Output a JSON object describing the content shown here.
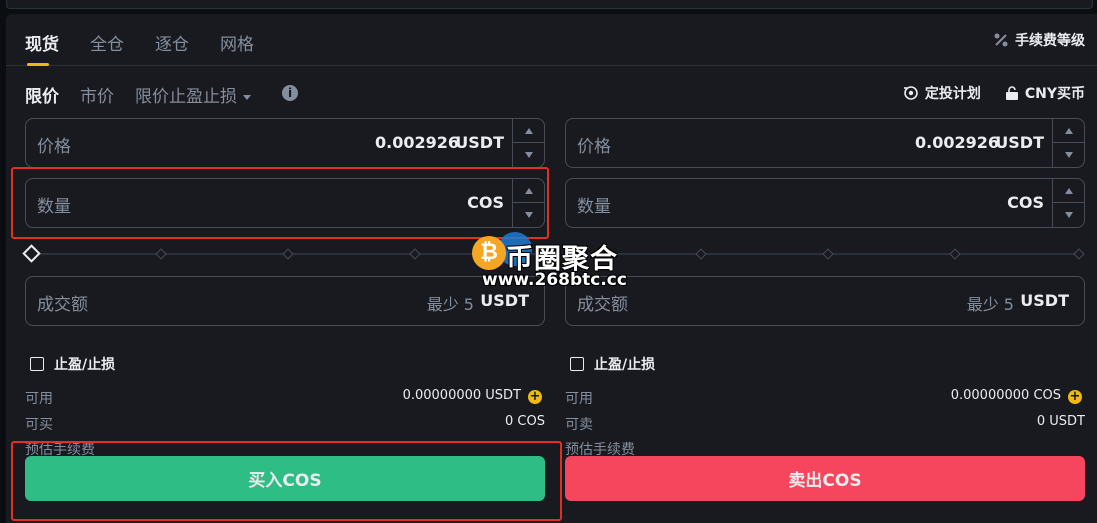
{
  "tabs": [
    {
      "label": "现货",
      "active": true
    },
    {
      "label": "全仓",
      "active": false
    },
    {
      "label": "逐仓",
      "active": false
    },
    {
      "label": "网格",
      "active": false
    }
  ],
  "fee_link": {
    "icon": "percent-icon",
    "label": "手续费等级"
  },
  "order_types": {
    "limit": "限价",
    "market": "市价",
    "stop_limit": "限价止盈止损"
  },
  "right_links": {
    "auto_invest": "定投计划",
    "cny_buy": "CNY买币"
  },
  "buy": {
    "price_label": "价格",
    "price_value": "0.002926",
    "price_unit": "USDT",
    "amount_label": "数量",
    "amount_unit": "COS",
    "total_label": "成交额",
    "total_placeholder": "最少 5",
    "total_unit": "USDT",
    "tpsl_label": "止盈/止损",
    "avail_label": "可用",
    "avail_value": "0.00000000 USDT",
    "max_label": "可买",
    "max_value": "0 COS",
    "fee_label": "预估手续费",
    "button": "买入COS"
  },
  "sell": {
    "price_label": "价格",
    "price_value": "0.002926",
    "price_unit": "USDT",
    "amount_label": "数量",
    "amount_unit": "COS",
    "total_label": "成交额",
    "total_placeholder": "最少 5",
    "total_unit": "USDT",
    "tpsl_label": "止盈/止损",
    "avail_label": "可用",
    "avail_value": "0.00000000 COS",
    "max_label": "可卖",
    "max_value": "0 USDT",
    "fee_label": "预估手续费",
    "button": "卖出COS"
  },
  "watermark": {
    "title": "币圈聚合",
    "url": "www.268btc.cc",
    "coin_symbol": "₿"
  },
  "colors": {
    "buy": "#2ebd85",
    "sell": "#f6465d",
    "accent": "#f0b90b",
    "highlight": "#e03020"
  }
}
